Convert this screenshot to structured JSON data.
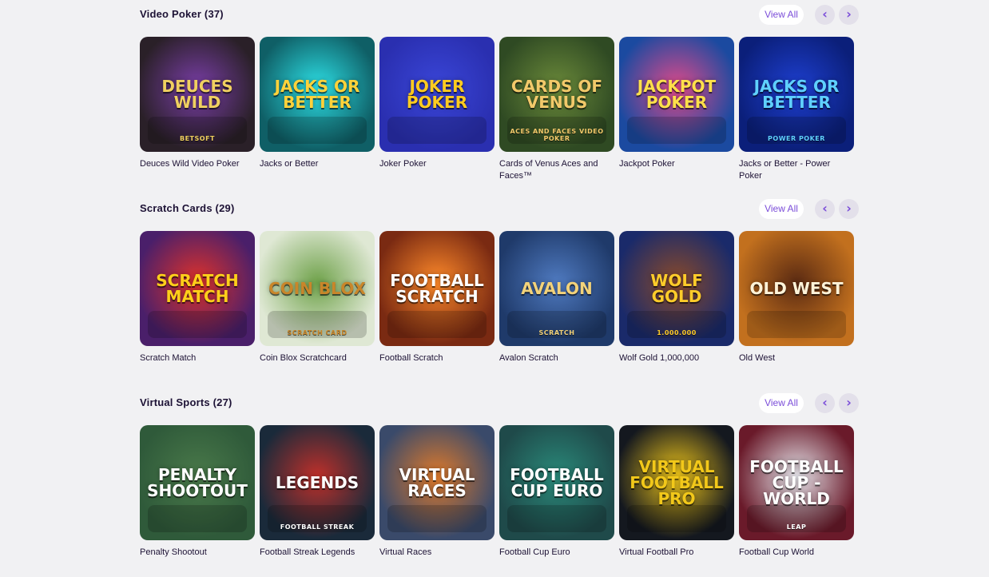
{
  "sections": [
    {
      "title": "Video Poker (37)",
      "view_all": "View All",
      "games": [
        {
          "name": "Deuces Wild Video Poker",
          "art": "Deuces Wild",
          "sub": "BETSOFT",
          "bg": "#2a2028",
          "fg": "#f0d060",
          "accent": "#7a3ea8"
        },
        {
          "name": "Jacks or Better",
          "art": "Jacks or Better",
          "sub": "",
          "bg": "#0f5f66",
          "fg": "#ffd23a",
          "accent": "#2de0e6"
        },
        {
          "name": "Joker Poker",
          "art": "Joker Poker",
          "sub": "",
          "bg": "#2a2fb0",
          "fg": "#ffcc1f",
          "accent": "#3a46d8"
        },
        {
          "name": "Cards of Venus Aces and Faces™",
          "art": "Cards of Venus",
          "sub": "ACES AND FACES VIDEO POKER",
          "bg": "#2f4a23",
          "fg": "#f2c96a",
          "accent": "#6b8a3a"
        },
        {
          "name": "Jackpot Poker",
          "art": "Jackpot Poker",
          "sub": "",
          "bg": "#1b4aa0",
          "fg": "#ffe04a",
          "accent": "#e04a8a"
        },
        {
          "name": "Jacks or Better - Power Poker",
          "art": "Jacks or Better",
          "sub": "POWER POKER",
          "bg": "#0b1f7a",
          "fg": "#5fd0ff",
          "accent": "#1e3fd0"
        }
      ]
    },
    {
      "title": "Scratch Cards (29)",
      "view_all": "View All",
      "games": [
        {
          "name": "Scratch Match",
          "art": "Scratch Match",
          "sub": "",
          "bg": "#4a1f6a",
          "fg": "#ffcf1a",
          "accent": "#e0322a"
        },
        {
          "name": "Coin Blox Scratchcard",
          "art": "Coin Blox",
          "sub": "SCRATCH CARD",
          "bg": "#dfe8d4",
          "fg": "#c9862a",
          "accent": "#6fa24a"
        },
        {
          "name": "Football Scratch",
          "art": "Football Scratch",
          "sub": "",
          "bg": "#7a2a12",
          "fg": "#ffffff",
          "accent": "#ff8a2a"
        },
        {
          "name": "Avalon Scratch",
          "art": "Avalon",
          "sub": "SCRATCH",
          "bg": "#1f3a6a",
          "fg": "#f2d27a",
          "accent": "#4f7ac0"
        },
        {
          "name": "Wolf Gold 1,000,000",
          "art": "Wolf Gold",
          "sub": "1.000.000",
          "bg": "#1a2a6a",
          "fg": "#ffcc2a",
          "accent": "#8a4a2a"
        },
        {
          "name": "Old West",
          "art": "Old West",
          "sub": "",
          "bg": "#c2701e",
          "fg": "#fff3d8",
          "accent": "#5a2a12"
        }
      ]
    },
    {
      "title": "Virtual Sports (27)",
      "view_all": "View All",
      "games": [
        {
          "name": "Penalty Shootout",
          "art": "Penalty Shootout",
          "sub": "",
          "bg": "#2f5a3a",
          "fg": "#ffffff",
          "accent": "#4a7a4a"
        },
        {
          "name": "Football Streak Legends",
          "art": "Legends",
          "sub": "FOOTBALL STREAK",
          "bg": "#1a2a3a",
          "fg": "#ffffff",
          "accent": "#c0302a"
        },
        {
          "name": "Virtual Races",
          "art": "Virtual Races",
          "sub": "",
          "bg": "#3a4a6a",
          "fg": "#ffffff",
          "accent": "#e07a2a"
        },
        {
          "name": "Football Cup Euro",
          "art": "Football Cup Euro",
          "sub": "",
          "bg": "#1f4a4a",
          "fg": "#ffffff",
          "accent": "#2a8a7a"
        },
        {
          "name": "Virtual Football Pro",
          "art": "Virtual Football Pro",
          "sub": "",
          "bg": "#14181f",
          "fg": "#f2c81a",
          "accent": "#f2c81a"
        },
        {
          "name": "Football Cup World",
          "art": "Football Cup - World",
          "sub": "LEAP",
          "bg": "#6a1a2a",
          "fg": "#ffffff",
          "accent": "#e8e8ee"
        }
      ]
    }
  ],
  "nav": {
    "prev_icon": "chevron-left-icon",
    "next_icon": "chevron-right-icon",
    "prev_glyph": "‹",
    "next_glyph": "›"
  }
}
